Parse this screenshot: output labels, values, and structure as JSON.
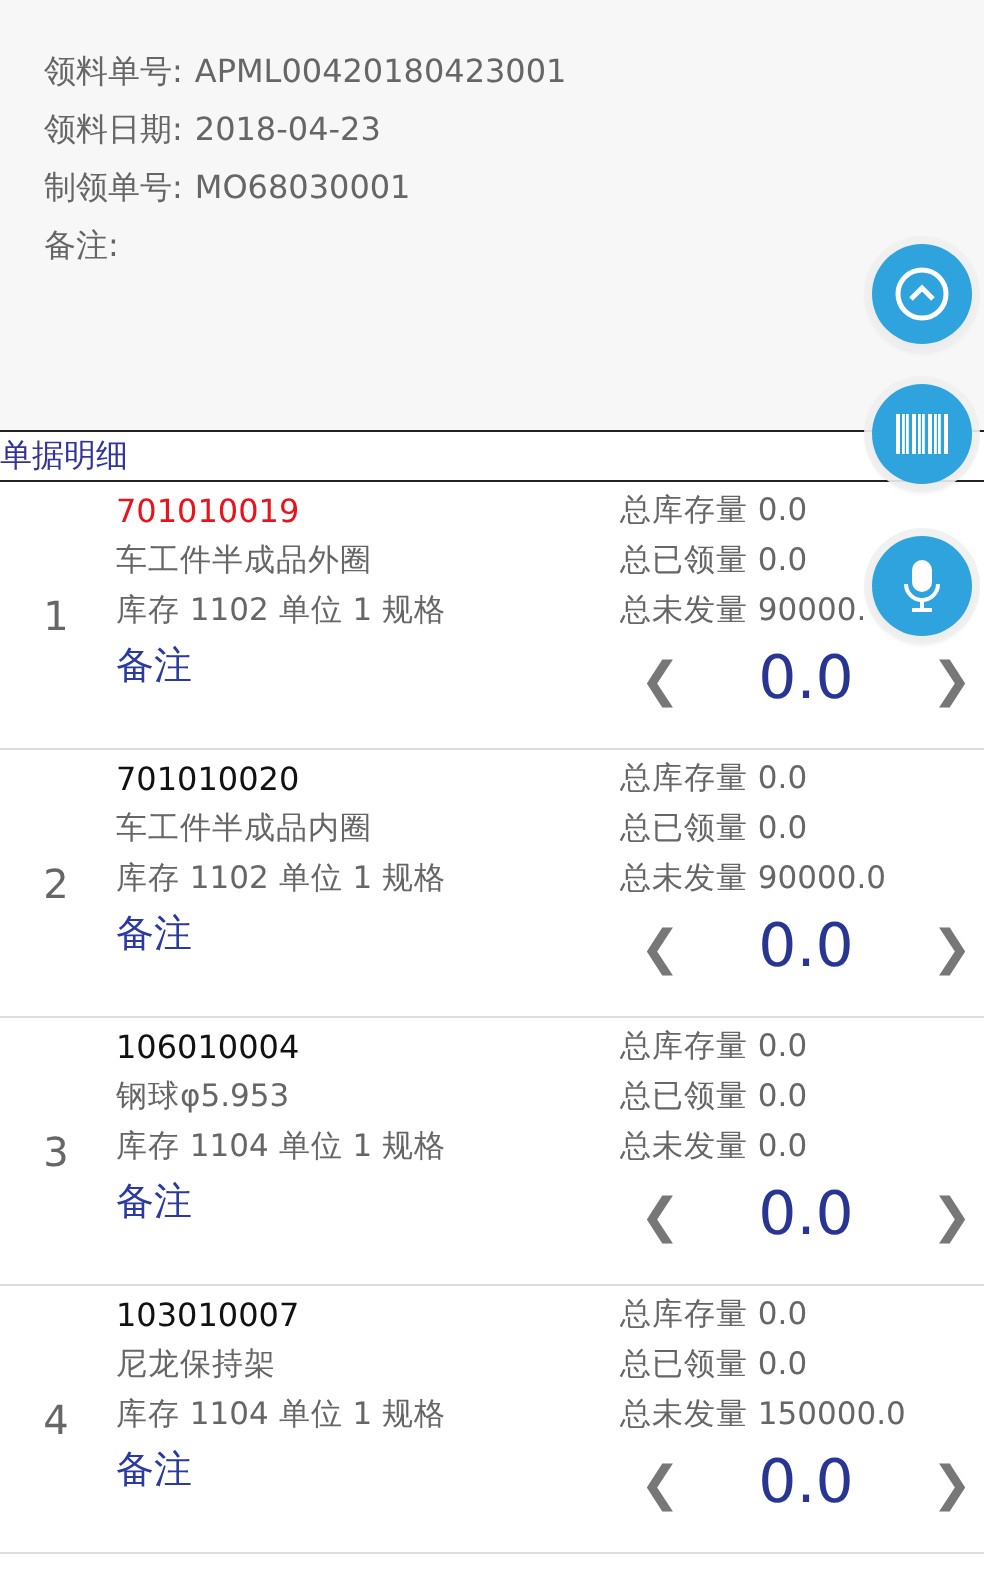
{
  "header": {
    "fields": [
      {
        "label": "领料单号:",
        "value": "APML00420180423001"
      },
      {
        "label": "领料日期:",
        "value": "2018-04-23"
      },
      {
        "label": "制领单号:",
        "value": "MO68030001"
      },
      {
        "label": "备注:"
      }
    ]
  },
  "fabs": [
    {
      "kind": "up"
    },
    {
      "kind": "barcode"
    },
    {
      "kind": "mic"
    }
  ],
  "section_title": "单据明细",
  "items": [
    {
      "index": "1",
      "code": "701010019",
      "highlighted": true,
      "name": "车工件半成品外圈",
      "stock": "库存 1102 单位 1 规格",
      "note": "备注",
      "totals": [
        "总库存量 0.0",
        "总已领量 0.0",
        "总未发量 90000."
      ],
      "quantity": "0.0",
      "prev": "❮",
      "next": "❯"
    },
    {
      "index": "2",
      "code": "701010020",
      "highlighted": false,
      "name": "车工件半成品内圈",
      "stock": "库存 1102 单位 1 规格",
      "note": "备注",
      "totals": [
        "总库存量 0.0",
        "总已领量 0.0",
        "总未发量 90000.0"
      ],
      "quantity": "0.0",
      "prev": "❮",
      "next": "❯"
    },
    {
      "index": "3",
      "code": "106010004",
      "highlighted": false,
      "name": "钢球φ5.953",
      "stock": "库存 1104 单位 1 规格",
      "note": "备注",
      "totals": [
        "总库存量 0.0",
        "总已领量 0.0",
        "总未发量 0.0"
      ],
      "quantity": "0.0",
      "prev": "❮",
      "next": "❯"
    },
    {
      "index": "4",
      "code": "103010007",
      "highlighted": false,
      "name": "尼龙保持架",
      "stock": "库存 1104 单位 1 规格",
      "note": "备注",
      "totals": [
        "总库存量 0.0",
        "总已领量 0.0",
        "总未发量 150000.0"
      ],
      "quantity": "0.0",
      "prev": "❮",
      "next": "❯"
    }
  ]
}
